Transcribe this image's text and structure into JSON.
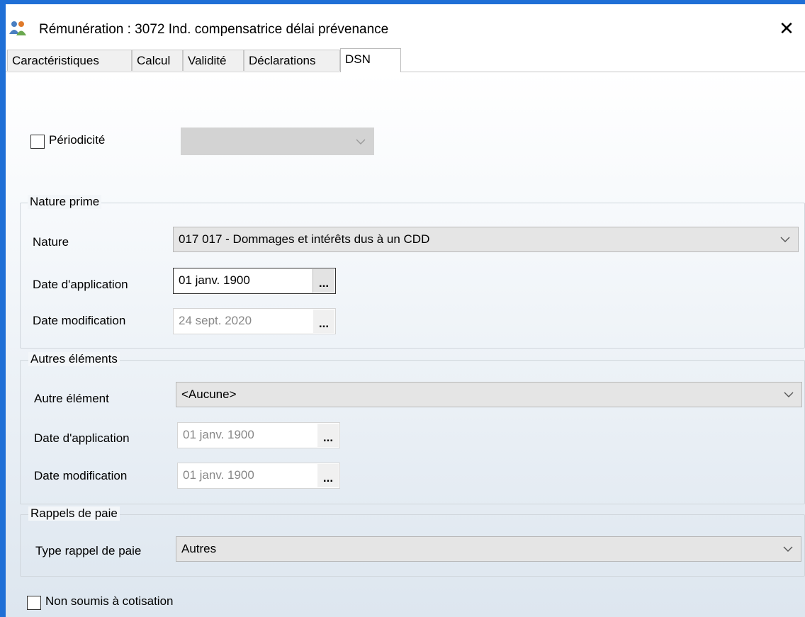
{
  "window": {
    "title": "Rémunération  : 3072 Ind. compensatrice délai prévenance",
    "close_glyph": "✕"
  },
  "tabs": [
    {
      "label": "Caractéristiques"
    },
    {
      "label": "Calcul"
    },
    {
      "label": "Validité"
    },
    {
      "label": "Déclarations"
    },
    {
      "label": "DSN",
      "active": true
    }
  ],
  "periodicite": {
    "label": "Périodicité",
    "checked": false,
    "value": ""
  },
  "nature_prime": {
    "title": "Nature prime",
    "nature_label": "Nature",
    "nature_value": "017  017 - Dommages et intérêts dus à un CDD",
    "date_application_label": "Date d'application",
    "date_application_value": "01 janv. 1900",
    "date_modification_label": "Date modification",
    "date_modification_value": "24 sept. 2020"
  },
  "autres_elements": {
    "title": "Autres éléments",
    "autre_element_label": "Autre élément",
    "autre_element_value": "<Aucune>",
    "date_application_label": "Date d'application",
    "date_application_value": "01 janv. 1900",
    "date_modification_label": "Date modification",
    "date_modification_value": "01 janv. 1900"
  },
  "rappels_de_paie": {
    "title": "Rappels de paie",
    "type_label": "Type rappel de paie",
    "type_value": "Autres"
  },
  "non_soumis": {
    "label": "Non soumis à cotisation",
    "checked": false
  },
  "ellipsis": "...",
  "colors": {
    "accent_border": "#1f6fd6"
  },
  "icons": {
    "app": "user-pay-icon",
    "dropdown": "chevron-down-icon"
  }
}
